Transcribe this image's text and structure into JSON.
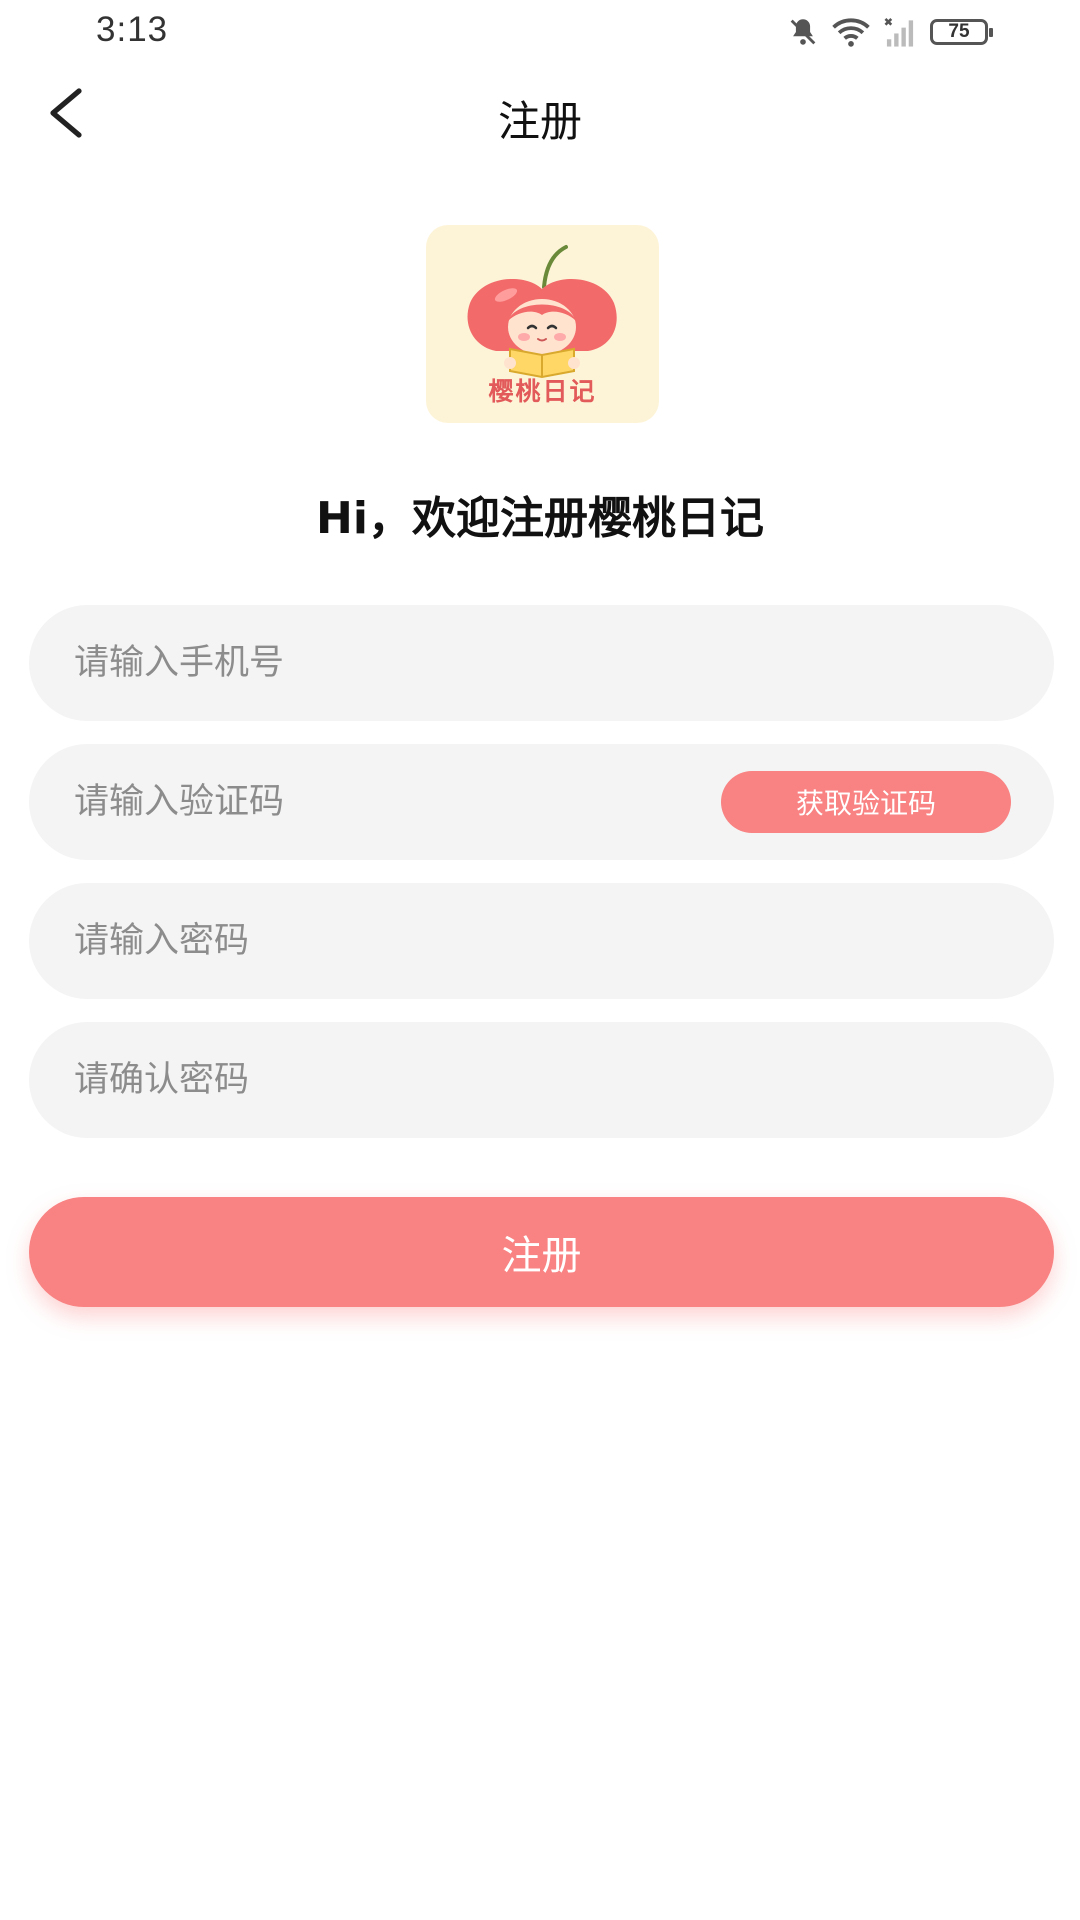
{
  "status_bar": {
    "time": "3:13",
    "battery": "75",
    "icons": [
      "bell-muted-icon",
      "wifi-icon",
      "signal-icon",
      "battery-icon"
    ]
  },
  "nav": {
    "back_icon": "chevron-left-icon",
    "title": "注册"
  },
  "logo": {
    "icon": "cherry-girl-reading-icon",
    "text": "樱桃日记"
  },
  "welcome": "Hi，欢迎注册樱桃日记",
  "form": {
    "phone_placeholder": "请输入手机号",
    "code_placeholder": "请输入验证码",
    "code_button": "获取验证码",
    "password_placeholder": "请输入密码",
    "confirm_placeholder": "请确认密码",
    "submit": "注册"
  },
  "colors": {
    "accent": "#f98282",
    "field_bg": "#f4f4f4",
    "logo_bg": "#fdf4d8"
  }
}
